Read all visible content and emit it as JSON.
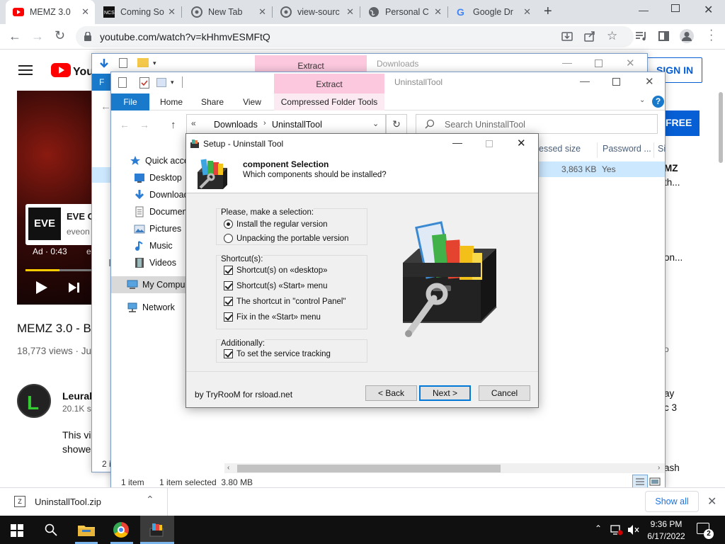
{
  "browser": {
    "tabs": [
      {
        "title": "MEMZ 3.0",
        "favicon": "youtube-icon",
        "active": true
      },
      {
        "title": "Coming So",
        "favicon": "ncs-icon"
      },
      {
        "title": "New Tab",
        "favicon": "chrome-icon"
      },
      {
        "title": "view-sourc",
        "favicon": "chrome-icon"
      },
      {
        "title": "Personal C",
        "favicon": "globe-icon"
      },
      {
        "title": "Google Dr",
        "favicon": "google-icon"
      }
    ],
    "url": "youtube.com/watch?v=kHhmvESMFtQ"
  },
  "youtube": {
    "sign_in": "SIGN IN",
    "video_title": "MEMZ 3.0 - B",
    "views": "18,773 views · Ju",
    "ad_brand": "EVE O",
    "ad_site": "eveon",
    "ad_time": "Ad · 0:43",
    "ad_site2": "e",
    "channel_name": "Leurak",
    "subscribers": "20.1K s",
    "desc_line1": "This vi",
    "desc_line2": "showe",
    "free_button": "FREE",
    "right_texts": [
      "MZ",
      "th...",
      "on...",
      "o",
      "ay",
      "c 3",
      "ash"
    ]
  },
  "explorer_back": {
    "ribbon_tab": "Extract",
    "title": "Downloads",
    "file_tab": "F",
    "status": "2 i"
  },
  "explorer_front": {
    "title": "UninstallTool",
    "context_tab": "Extract",
    "tabs": [
      "File",
      "Home",
      "Share",
      "View",
      "Compressed Folder Tools"
    ],
    "breadcrumb": [
      "Downloads",
      "UninstallTool"
    ],
    "search_placeholder": "Search UninstallTool",
    "columns": [
      "essed size",
      "Password ...",
      "Si"
    ],
    "row": {
      "size": "3,863 KB",
      "password": "Yes"
    },
    "nav": [
      "Quick acces",
      "Desktop",
      "Download",
      "Documen",
      "Pictures",
      "Music",
      "Videos",
      "My Compu",
      "Network"
    ],
    "status_items": "1 item",
    "status_selected": "1 item selected  3.80 MB"
  },
  "dialog": {
    "title": "Setup - Uninstall Tool",
    "heading": "component Selection",
    "subheading": "Which components should be installed?",
    "group1_label": "Please, make a selection:",
    "radio1": "Install the regular version",
    "radio2": "Unpacking the portable version",
    "group2_label": "Shortcut(s):",
    "check1": "Shortcut(s) on «desktop»",
    "check2": "Shortcut(s) «Start» menu",
    "check3": "The shortcut in \"control Panel\"",
    "check4": "Fix in the «Start» menu",
    "group3_label": "Additionally:",
    "check5": "To set the service tracking",
    "credit": "by TryRooM for rsload.net",
    "back": "< Back",
    "next": "Next >",
    "cancel": "Cancel"
  },
  "downloads": {
    "file": "UninstallTool.zip",
    "show_all": "Show all"
  },
  "taskbar": {
    "time": "9:36 PM",
    "date": "6/17/2022",
    "notifications": "2"
  }
}
